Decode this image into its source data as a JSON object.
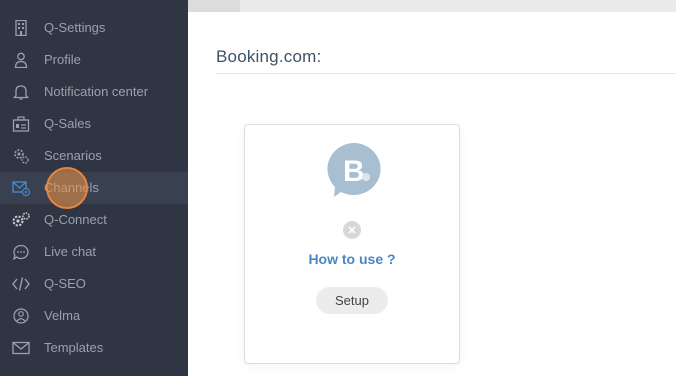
{
  "sidebar": {
    "items": [
      {
        "label": "Q-Settings",
        "icon": "building-icon"
      },
      {
        "label": "Profile",
        "icon": "user-icon"
      },
      {
        "label": "Notification center",
        "icon": "bell-icon"
      },
      {
        "label": "Q-Sales",
        "icon": "sales-icon"
      },
      {
        "label": "Scenarios",
        "icon": "gears-icon"
      },
      {
        "label": "Channels",
        "icon": "channels-icon",
        "active": true
      },
      {
        "label": "Q-Connect",
        "icon": "connect-gears-icon"
      },
      {
        "label": "Live chat",
        "icon": "chat-icon"
      },
      {
        "label": "Q-SEO",
        "icon": "code-icon"
      },
      {
        "label": "Velma",
        "icon": "velma-icon"
      },
      {
        "label": "Templates",
        "icon": "mail-icon"
      }
    ]
  },
  "main": {
    "title": "Booking.com:",
    "card": {
      "logo_letter": "B",
      "logo_color": "#a8bfd1",
      "how_to_use": "How to use ?",
      "setup_label": "Setup"
    }
  },
  "colors": {
    "sidebar_bg": "#2f3542",
    "sidebar_active": "#394050",
    "sidebar_text": "#9aa1ae",
    "accent": "#4a86c5",
    "cursor": "#e8843c"
  }
}
